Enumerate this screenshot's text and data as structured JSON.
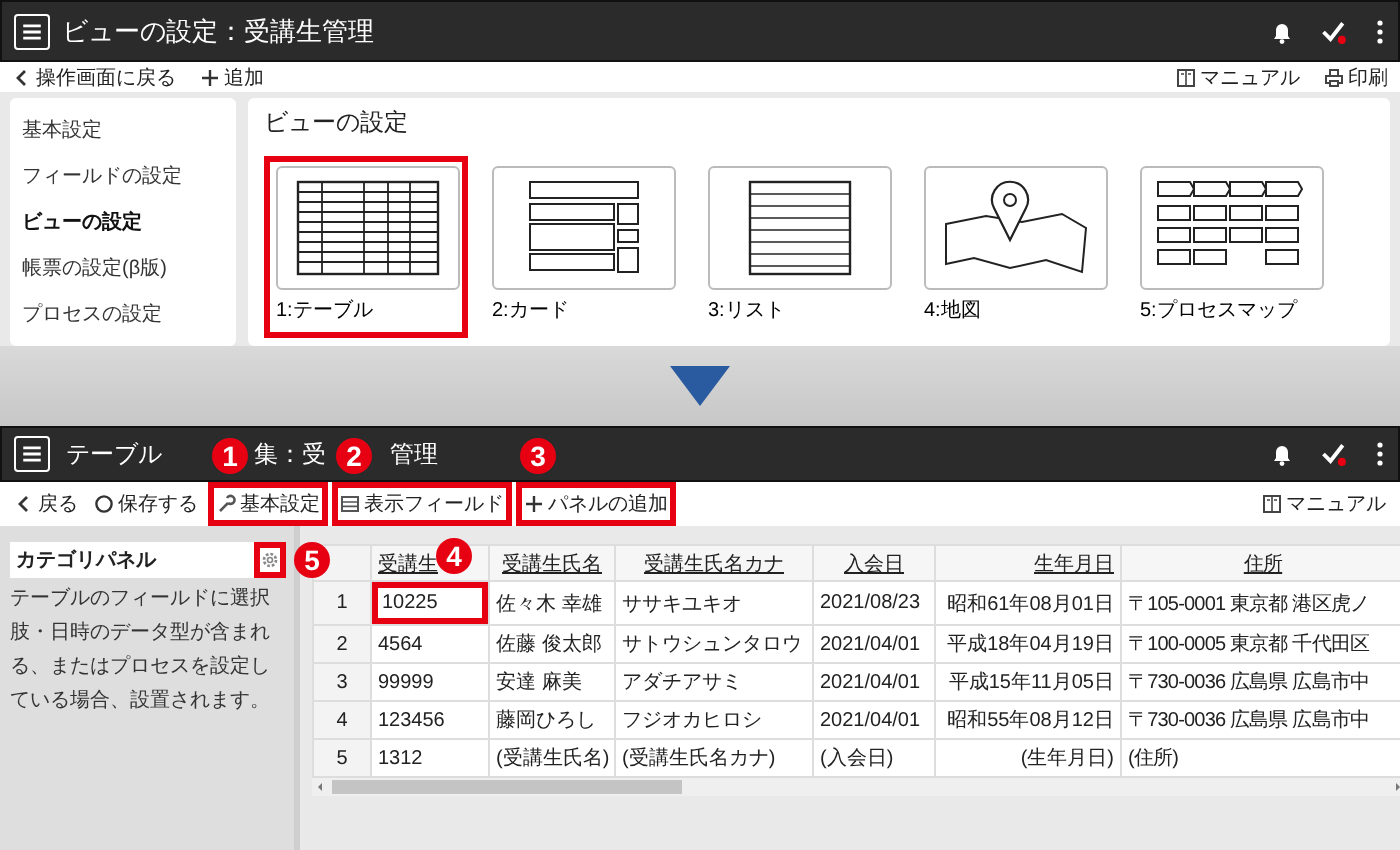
{
  "top_screen": {
    "header": {
      "title": "ビューの設定：受講生管理"
    },
    "toolbar": {
      "left": [
        {
          "kind": "back",
          "label": "操作画面に戻る"
        },
        {
          "kind": "add",
          "label": "追加"
        }
      ],
      "right": [
        {
          "kind": "manual",
          "label": "マニュアル"
        },
        {
          "kind": "print",
          "label": "印刷"
        }
      ]
    },
    "sidebar": {
      "items": [
        {
          "label": "基本設定",
          "selected": false
        },
        {
          "label": "フィールドの設定",
          "selected": false
        },
        {
          "label": "ビューの設定",
          "selected": true
        },
        {
          "label": "帳票の設定(β版)",
          "selected": false
        },
        {
          "label": "プロセスの設定",
          "selected": false
        }
      ]
    },
    "panel": {
      "title": "ビューの設定",
      "view_types": [
        {
          "kind": "table",
          "label": "1:テーブル",
          "highlighted": true
        },
        {
          "kind": "card",
          "label": "2:カード",
          "highlighted": false
        },
        {
          "kind": "list",
          "label": "3:リスト",
          "highlighted": false
        },
        {
          "kind": "map",
          "label": "4:地図",
          "highlighted": false
        },
        {
          "kind": "process",
          "label": "5:プロセスマップ",
          "highlighted": false
        }
      ]
    }
  },
  "bottom_screen": {
    "header": {
      "title_fragments": [
        "テーブル",
        "集：受",
        "管理"
      ]
    },
    "toolbar": {
      "left": [
        {
          "kind": "back",
          "label": "戻る"
        },
        {
          "kind": "save",
          "label": "保存する"
        },
        {
          "kind": "settings",
          "label": "基本設定",
          "callout": "1"
        },
        {
          "kind": "fields",
          "label": "表示フィールド",
          "callout": "2"
        },
        {
          "kind": "add",
          "label": "パネルの追加",
          "callout": "3"
        }
      ],
      "right": [
        {
          "kind": "manual",
          "label": "マニュアル"
        }
      ]
    },
    "category_panel": {
      "title": "カテゴリパネル",
      "settings_callout": "5",
      "description": "テーブルのフィールドに選択肢・日時のデータ型が含まれる、またはプロセスを設定している場合、設置されます。"
    },
    "table": {
      "columns": [
        {
          "label": "受講生",
          "callout": "4"
        },
        {
          "label": "受講生氏名"
        },
        {
          "label": "受講生氏名カナ"
        },
        {
          "label": "入会日"
        },
        {
          "label": "生年月日"
        },
        {
          "label": "住所"
        }
      ],
      "rows": [
        {
          "number": "1",
          "cells": [
            "10225",
            "佐々木 幸雄",
            "ササキユキオ",
            "2021/08/23",
            "昭和61年08月01日",
            "〒105-0001 東京都 港区虎ノ"
          ],
          "first_cell_highlighted": true
        },
        {
          "number": "2",
          "cells": [
            "4564",
            "佐藤 俊太郎",
            "サトウシュンタロウ",
            "2021/04/01",
            "平成18年04月19日",
            "〒100-0005 東京都 千代田区"
          ]
        },
        {
          "number": "3",
          "cells": [
            "99999",
            "安達 麻美",
            "アダチアサミ",
            "2021/04/01",
            "平成15年11月05日",
            "〒730-0036 広島県 広島市中"
          ]
        },
        {
          "number": "4",
          "cells": [
            "123456",
            "藤岡ひろし",
            "フジオカヒロシ",
            "2021/04/01",
            "昭和55年08月12日",
            "〒730-0036 広島県 広島市中"
          ]
        },
        {
          "number": "5",
          "cells": [
            "1312",
            "(受講生氏名)",
            "(受講生氏名カナ)",
            "(入会日)",
            "(生年月日)",
            "(住所)"
          ]
        }
      ]
    }
  }
}
